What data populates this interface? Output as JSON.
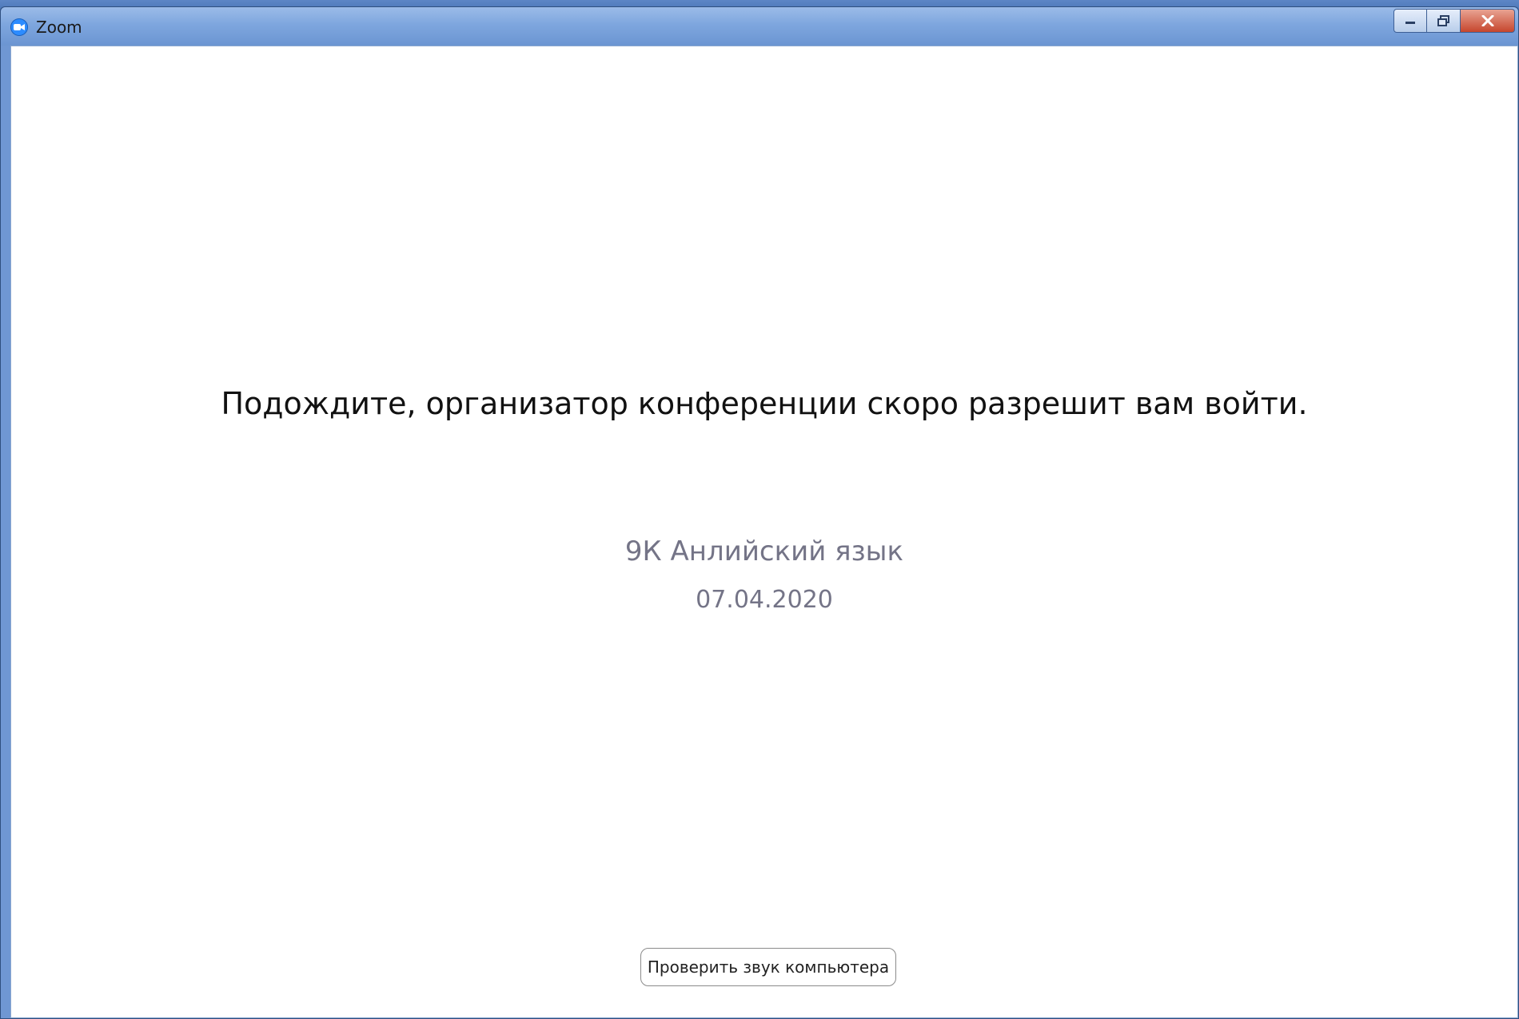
{
  "window": {
    "title": "Zoom",
    "controls": {
      "minimize_icon": "minimize-icon",
      "maximize_icon": "restore-icon",
      "close_icon": "close-icon"
    }
  },
  "waiting_room": {
    "message": "Подождите, организатор конференции скоро разрешит вам войти.",
    "meeting_name": "9К Анлийский язык",
    "meeting_date": "07.04.2020",
    "test_audio_button": "Проверить звук компьютера"
  },
  "colors": {
    "titlebar": "#7ea6de",
    "zoom_blue": "#2d8cff",
    "secondary_text": "#747487",
    "close_button": "#c6462d"
  }
}
